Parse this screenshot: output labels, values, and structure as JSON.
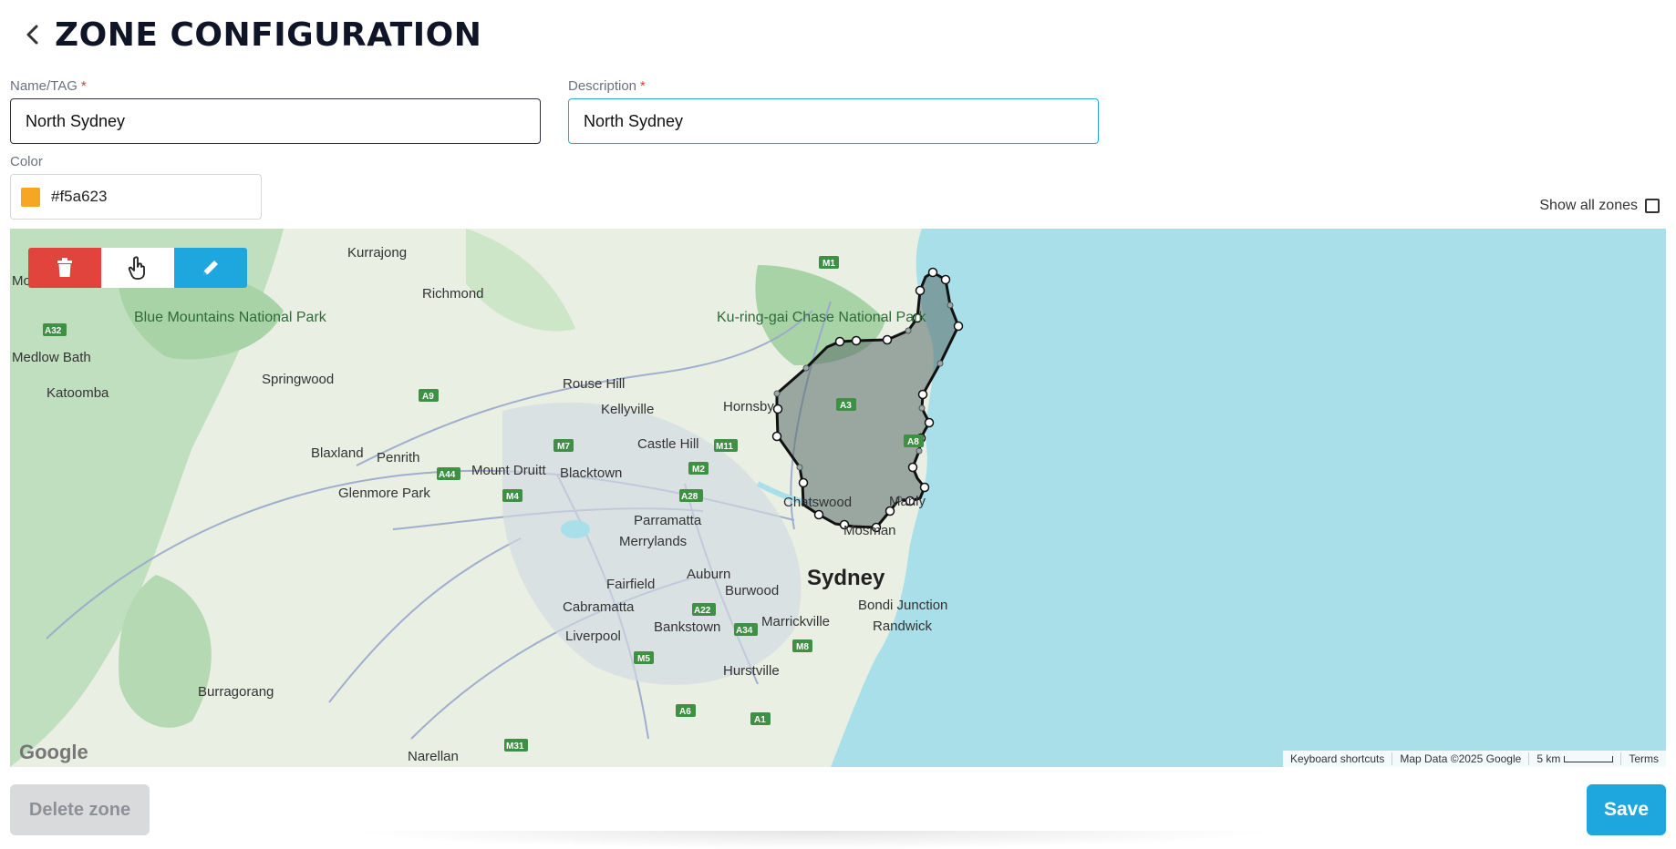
{
  "header": {
    "title": "ZONE CONFIGURATION",
    "back_icon": "chevron-left-icon"
  },
  "form": {
    "name": {
      "label": "Name/TAG",
      "required_mark": "*",
      "value": "North Sydney"
    },
    "description": {
      "label": "Description",
      "required_mark": "*",
      "value": "North Sydney"
    },
    "color": {
      "label": "Color",
      "value": "#f5a623",
      "swatch": "#f5a623"
    }
  },
  "show_all_zones": {
    "label": "Show all zones",
    "checked": false
  },
  "map": {
    "toolbar": [
      {
        "name": "delete",
        "icon": "trash-icon",
        "color": "#e0443d"
      },
      {
        "name": "pan",
        "icon": "hand-pointer-icon",
        "color": "#ffffff"
      },
      {
        "name": "edit",
        "icon": "pencil-icon",
        "color": "#1ea7df"
      }
    ],
    "place_labels": [
      "Kurrajong",
      "Mount Victoria",
      "Blue Mountains National Park",
      "Richmond",
      "Medlow Bath",
      "Springwood",
      "Katoomba",
      "Rouse Hill",
      "Kellyville",
      "Hornsby",
      "Ku-ring-gai Chase National Park",
      "Castle Hill",
      "Blaxland",
      "Penrith",
      "Mount Druitt",
      "Blacktown",
      "Glenmore Park",
      "Chatswood",
      "Manly",
      "Parramatta",
      "Merrylands",
      "Mosman",
      "Sydney",
      "Fairfield",
      "Auburn",
      "Burwood",
      "Bondi Junction",
      "Cabramatta",
      "Randwick",
      "Marrickville",
      "Bankstown",
      "Liverpool",
      "Hurstville",
      "Burragorang",
      "Narellan"
    ],
    "road_labels": [
      "M1",
      "A32",
      "A9",
      "M7",
      "M11",
      "A3",
      "A8",
      "M2",
      "A44",
      "M4",
      "A28",
      "A22",
      "A34",
      "M8",
      "M5",
      "A6",
      "A1",
      "M31"
    ],
    "attribution": {
      "logo": "Google",
      "keyboard_shortcuts": "Keyboard shortcuts",
      "map_data": "Map Data ©2025 Google",
      "scale": "5 km",
      "terms": "Terms"
    },
    "zone_fill": "#5a6b6a",
    "water_color": "#a9dfe9",
    "land_color": "#e8efe4"
  },
  "actions": {
    "delete_label": "Delete zone",
    "save_label": "Save"
  }
}
